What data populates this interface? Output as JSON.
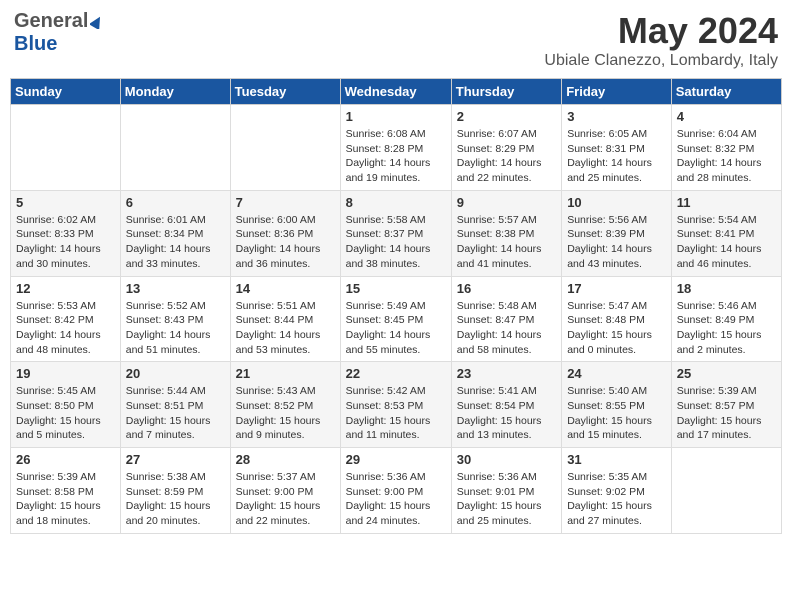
{
  "header": {
    "logo_general": "General",
    "logo_blue": "Blue",
    "month": "May 2024",
    "location": "Ubiale Clanezzo, Lombardy, Italy"
  },
  "calendar": {
    "days_of_week": [
      "Sunday",
      "Monday",
      "Tuesday",
      "Wednesday",
      "Thursday",
      "Friday",
      "Saturday"
    ],
    "weeks": [
      [
        {
          "day": "",
          "info": ""
        },
        {
          "day": "",
          "info": ""
        },
        {
          "day": "",
          "info": ""
        },
        {
          "day": "1",
          "info": "Sunrise: 6:08 AM\nSunset: 8:28 PM\nDaylight: 14 hours\nand 19 minutes."
        },
        {
          "day": "2",
          "info": "Sunrise: 6:07 AM\nSunset: 8:29 PM\nDaylight: 14 hours\nand 22 minutes."
        },
        {
          "day": "3",
          "info": "Sunrise: 6:05 AM\nSunset: 8:31 PM\nDaylight: 14 hours\nand 25 minutes."
        },
        {
          "day": "4",
          "info": "Sunrise: 6:04 AM\nSunset: 8:32 PM\nDaylight: 14 hours\nand 28 minutes."
        }
      ],
      [
        {
          "day": "5",
          "info": "Sunrise: 6:02 AM\nSunset: 8:33 PM\nDaylight: 14 hours\nand 30 minutes."
        },
        {
          "day": "6",
          "info": "Sunrise: 6:01 AM\nSunset: 8:34 PM\nDaylight: 14 hours\nand 33 minutes."
        },
        {
          "day": "7",
          "info": "Sunrise: 6:00 AM\nSunset: 8:36 PM\nDaylight: 14 hours\nand 36 minutes."
        },
        {
          "day": "8",
          "info": "Sunrise: 5:58 AM\nSunset: 8:37 PM\nDaylight: 14 hours\nand 38 minutes."
        },
        {
          "day": "9",
          "info": "Sunrise: 5:57 AM\nSunset: 8:38 PM\nDaylight: 14 hours\nand 41 minutes."
        },
        {
          "day": "10",
          "info": "Sunrise: 5:56 AM\nSunset: 8:39 PM\nDaylight: 14 hours\nand 43 minutes."
        },
        {
          "day": "11",
          "info": "Sunrise: 5:54 AM\nSunset: 8:41 PM\nDaylight: 14 hours\nand 46 minutes."
        }
      ],
      [
        {
          "day": "12",
          "info": "Sunrise: 5:53 AM\nSunset: 8:42 PM\nDaylight: 14 hours\nand 48 minutes."
        },
        {
          "day": "13",
          "info": "Sunrise: 5:52 AM\nSunset: 8:43 PM\nDaylight: 14 hours\nand 51 minutes."
        },
        {
          "day": "14",
          "info": "Sunrise: 5:51 AM\nSunset: 8:44 PM\nDaylight: 14 hours\nand 53 minutes."
        },
        {
          "day": "15",
          "info": "Sunrise: 5:49 AM\nSunset: 8:45 PM\nDaylight: 14 hours\nand 55 minutes."
        },
        {
          "day": "16",
          "info": "Sunrise: 5:48 AM\nSunset: 8:47 PM\nDaylight: 14 hours\nand 58 minutes."
        },
        {
          "day": "17",
          "info": "Sunrise: 5:47 AM\nSunset: 8:48 PM\nDaylight: 15 hours\nand 0 minutes."
        },
        {
          "day": "18",
          "info": "Sunrise: 5:46 AM\nSunset: 8:49 PM\nDaylight: 15 hours\nand 2 minutes."
        }
      ],
      [
        {
          "day": "19",
          "info": "Sunrise: 5:45 AM\nSunset: 8:50 PM\nDaylight: 15 hours\nand 5 minutes."
        },
        {
          "day": "20",
          "info": "Sunrise: 5:44 AM\nSunset: 8:51 PM\nDaylight: 15 hours\nand 7 minutes."
        },
        {
          "day": "21",
          "info": "Sunrise: 5:43 AM\nSunset: 8:52 PM\nDaylight: 15 hours\nand 9 minutes."
        },
        {
          "day": "22",
          "info": "Sunrise: 5:42 AM\nSunset: 8:53 PM\nDaylight: 15 hours\nand 11 minutes."
        },
        {
          "day": "23",
          "info": "Sunrise: 5:41 AM\nSunset: 8:54 PM\nDaylight: 15 hours\nand 13 minutes."
        },
        {
          "day": "24",
          "info": "Sunrise: 5:40 AM\nSunset: 8:55 PM\nDaylight: 15 hours\nand 15 minutes."
        },
        {
          "day": "25",
          "info": "Sunrise: 5:39 AM\nSunset: 8:57 PM\nDaylight: 15 hours\nand 17 minutes."
        }
      ],
      [
        {
          "day": "26",
          "info": "Sunrise: 5:39 AM\nSunset: 8:58 PM\nDaylight: 15 hours\nand 18 minutes."
        },
        {
          "day": "27",
          "info": "Sunrise: 5:38 AM\nSunset: 8:59 PM\nDaylight: 15 hours\nand 20 minutes."
        },
        {
          "day": "28",
          "info": "Sunrise: 5:37 AM\nSunset: 9:00 PM\nDaylight: 15 hours\nand 22 minutes."
        },
        {
          "day": "29",
          "info": "Sunrise: 5:36 AM\nSunset: 9:00 PM\nDaylight: 15 hours\nand 24 minutes."
        },
        {
          "day": "30",
          "info": "Sunrise: 5:36 AM\nSunset: 9:01 PM\nDaylight: 15 hours\nand 25 minutes."
        },
        {
          "day": "31",
          "info": "Sunrise: 5:35 AM\nSunset: 9:02 PM\nDaylight: 15 hours\nand 27 minutes."
        },
        {
          "day": "",
          "info": ""
        }
      ]
    ]
  }
}
